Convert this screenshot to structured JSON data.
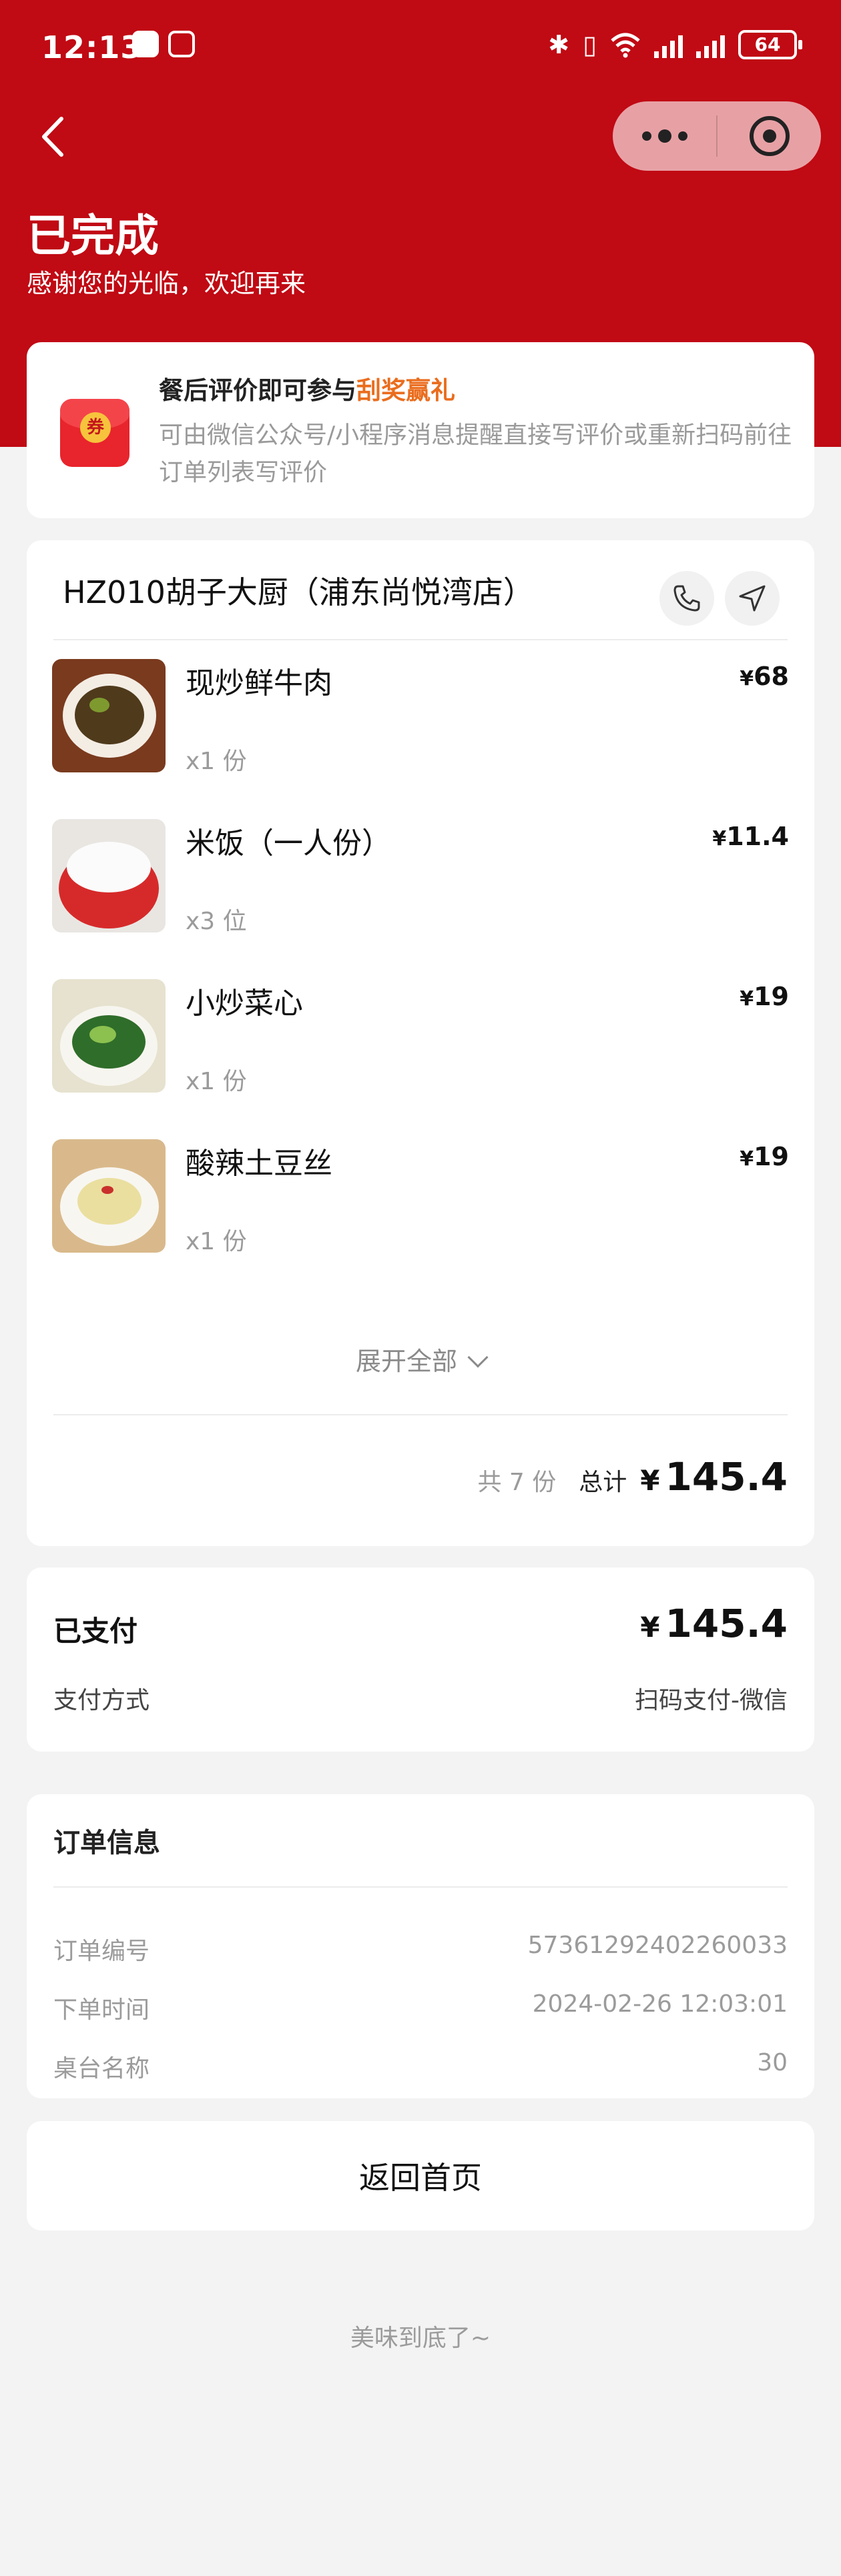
{
  "status_bar": {
    "time": "12:13",
    "battery": "64"
  },
  "header": {
    "title": "已完成",
    "subtitle": "感谢您的光临，欢迎再来"
  },
  "promo": {
    "coupon_text": "券",
    "title_prefix": "餐后评价即可参与",
    "title_highlight": "刮奖赢礼",
    "description": "可由微信公众号/小程序消息提醒直接写评价或重新扫码前往订单列表写评价"
  },
  "order": {
    "store_name": "HZ010胡子大厨（浦东尚悦湾店）",
    "currency": "¥",
    "items": [
      {
        "name": "现炒鲜牛肉",
        "qty": "x1 份",
        "price": "68"
      },
      {
        "name": "米饭（一人份）",
        "qty": "x3 位",
        "price": "11.4"
      },
      {
        "name": "小炒菜心",
        "qty": "x1 份",
        "price": "19"
      },
      {
        "name": "酸辣土豆丝",
        "qty": "x1 份",
        "price": "19"
      }
    ],
    "expand_label": "展开全部",
    "total_count": "共 7 份",
    "total_label": "总计",
    "total_amount": "145.4"
  },
  "payment": {
    "label": "已支付",
    "amount": "145.4",
    "method_label": "支付方式",
    "method_value": "扫码支付-微信"
  },
  "info": {
    "title": "订单信息",
    "rows": [
      {
        "label": "订单编号",
        "value": "57361292402260033"
      },
      {
        "label": "下单时间",
        "value": "2024-02-26 12:03:01"
      },
      {
        "label": "桌台名称",
        "value": "30"
      }
    ]
  },
  "home_button": "返回首页",
  "footer_note": "美味到底了~",
  "colors": {
    "brand_red": "#c00a14",
    "highlight_orange": "#ea6d1e"
  }
}
